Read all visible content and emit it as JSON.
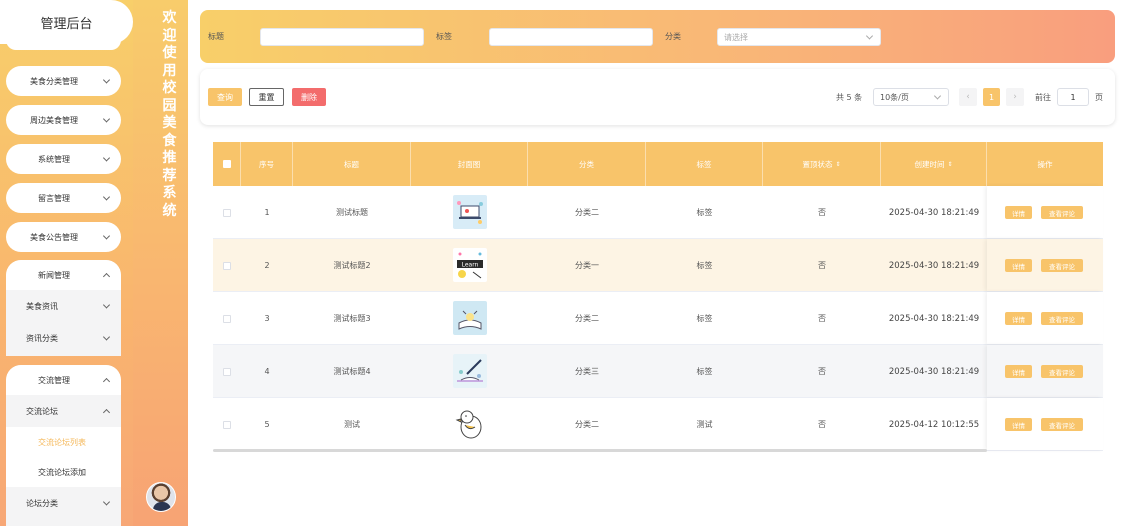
{
  "sidebar": {
    "title": "管理后台",
    "items": [
      {
        "label": "美食分类管理"
      },
      {
        "label": "周边美食管理"
      },
      {
        "label": "系统管理"
      },
      {
        "label": "留言管理"
      },
      {
        "label": "美食公告管理"
      }
    ],
    "news_group": {
      "label": "新闻管理",
      "subs": [
        {
          "label": "美食资讯"
        },
        {
          "label": "资讯分类"
        }
      ]
    },
    "comm_group": {
      "label": "交流管理",
      "forum": {
        "label": "交流论坛",
        "children": [
          {
            "label": "交流论坛列表",
            "active": true
          },
          {
            "label": "交流论坛添加"
          }
        ]
      },
      "category": {
        "label": "论坛分类"
      }
    }
  },
  "welcome": {
    "text": "欢迎使用校园美食推荐系统"
  },
  "search": {
    "title_label": "标题",
    "title_value": "",
    "tag_label": "标签",
    "tag_value": "",
    "category_label": "分类",
    "category_placeholder": "请选择"
  },
  "actions": {
    "query": "查询",
    "reset": "重置",
    "delete": "删除"
  },
  "pagination": {
    "total_text": "共 5 条",
    "page_size": "10条/页",
    "current_page": "1",
    "goto_label": "前往",
    "goto_value": "1",
    "page_unit": "页",
    "prev_icon": "‹",
    "next_icon": "›"
  },
  "table": {
    "headers": [
      "序号",
      "标题",
      "封面图",
      "分类",
      "标签",
      "置顶状态",
      "创建时间",
      "操作"
    ],
    "sort_glyph": "⇕",
    "op_detail": "详情",
    "op_comments": "查看评论",
    "rows": [
      {
        "index": "1",
        "title": "测试标题",
        "category": "分类二",
        "tag": "标签",
        "pinned": "否",
        "created": "2025-04-30 18:21:49",
        "thumb": "laptop-illustration"
      },
      {
        "index": "2",
        "title": "测试标题2",
        "category": "分类一",
        "tag": "标签",
        "pinned": "否",
        "created": "2025-04-30 18:21:49",
        "thumb": "learn-illustration"
      },
      {
        "index": "3",
        "title": "测试标题3",
        "category": "分类二",
        "tag": "标签",
        "pinned": "否",
        "created": "2025-04-30 18:21:49",
        "thumb": "book-illustration"
      },
      {
        "index": "4",
        "title": "测试标题4",
        "category": "分类三",
        "tag": "标签",
        "pinned": "否",
        "created": "2025-04-30 18:21:49",
        "thumb": "pen-illustration"
      },
      {
        "index": "5",
        "title": "测试",
        "category": "分类二",
        "tag": "测试",
        "pinned": "否",
        "created": "2025-04-12 10:12:55",
        "thumb": "duck-illustration"
      }
    ]
  },
  "colors": {
    "accent": "#f8c46a",
    "danger": "#f36c6c",
    "row_highlight": "#fdf4e4"
  }
}
